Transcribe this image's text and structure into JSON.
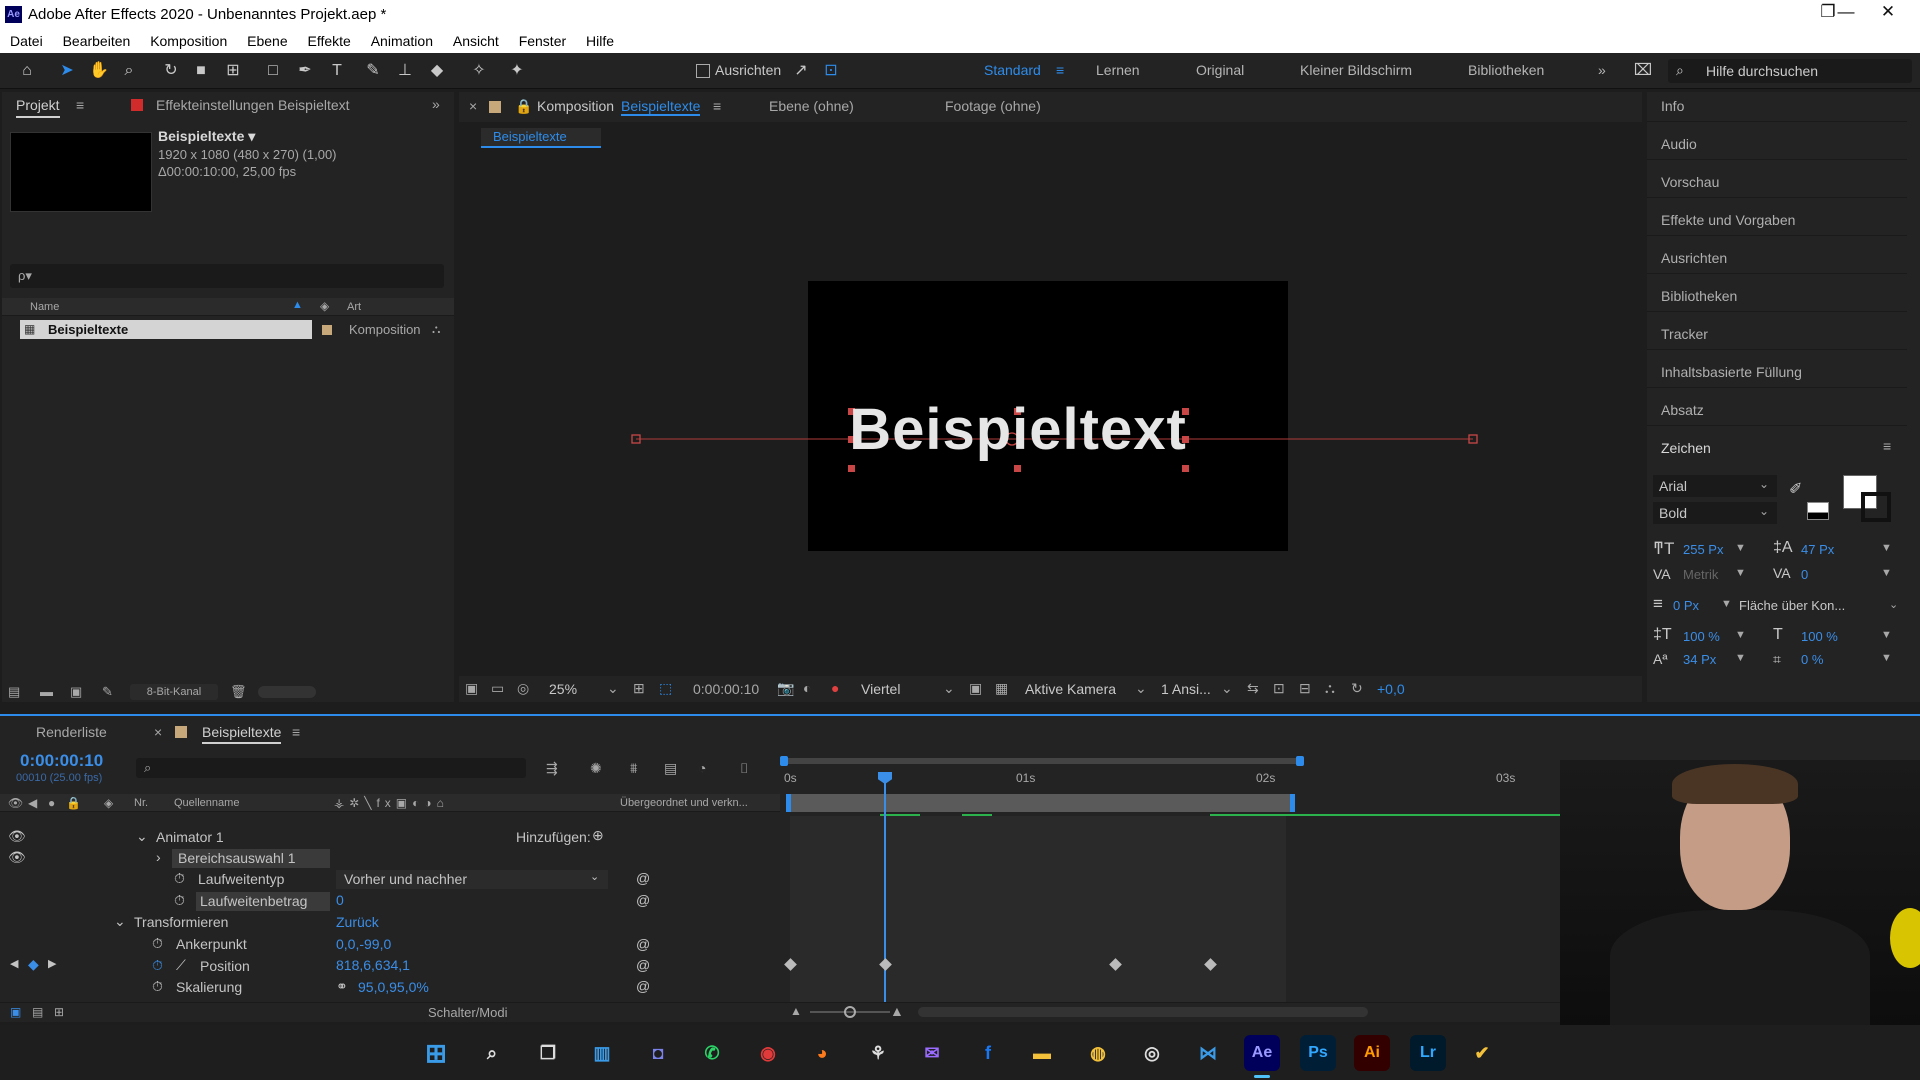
{
  "app": {
    "title": "Adobe After Effects 2020 - Unbenanntes Projekt.aep *",
    "icon": "Ae",
    "window_controls": [
      "—",
      "❐",
      "✕"
    ]
  },
  "menu": [
    "Datei",
    "Bearbeiten",
    "Komposition",
    "Ebene",
    "Effekte",
    "Animation",
    "Ansicht",
    "Fenster",
    "Hilfe"
  ],
  "toolbar": {
    "align_label": "Ausrichten",
    "workspaces": [
      "Standard",
      "Lernen",
      "Original",
      "Kleiner Bildschirm",
      "Bibliotheken"
    ],
    "active_workspace": "Standard",
    "overflow": "»",
    "search_placeholder": "Hilfe durchsuchen"
  },
  "project_panel": {
    "tab_project": "Projekt",
    "tab_effects": "Effekteinstellungen Beispieltext",
    "comp_name": "Beispieltexte ▾",
    "comp_info_1": "1920 x 1080 (480 x 270) (1,00)",
    "comp_info_2": "Δ00:00:10:00, 25,00 fps",
    "search_placeholder": "ρ▾",
    "col_name": "Name",
    "col_type": "Art",
    "item_name": "Beispieltexte",
    "item_type": "Komposition",
    "bit_depth": "8-Bit-Kanal"
  },
  "viewer": {
    "tab_comp_prefix": "Komposition",
    "tab_comp_name": "Beispieltexte",
    "tab_layer": "Ebene (ohne)",
    "tab_footage": "Footage (ohne)",
    "breadcrumb": "Beispieltexte",
    "canvas_text": "Beispieltext",
    "zoom": "25%",
    "timecode": "0:00:00:10",
    "resolution": "Viertel",
    "camera": "Aktive Kamera",
    "views": "1 Ansi...",
    "exposure": "+0,0"
  },
  "right_panel": {
    "items": [
      "Info",
      "Audio",
      "Vorschau",
      "Effekte und Vorgaben",
      "Ausrichten",
      "Bibliotheken",
      "Tracker",
      "Inhaltsbasierte Füllung",
      "Absatz"
    ],
    "zeichen_title": "Zeichen",
    "font": "Arial",
    "style": "Bold",
    "font_size": "255 Px",
    "leading": "47 Px",
    "kerning": "Metrik",
    "tracking": "0",
    "stroke_width": "0 Px",
    "stroke_mode": "Fläche über Kon...",
    "vscale": "100 %",
    "hscale": "100 %",
    "baseline": "34 Px",
    "tsume": "0 %",
    "fill_color": "#ffffff",
    "stroke_color": "#000000"
  },
  "timeline": {
    "tab_render": "Renderliste",
    "tab_comp": "Beispieltexte",
    "timecode": "0:00:00:10",
    "frame_info": "00010 (25.00 fps)",
    "col_nr": "Nr.",
    "col_source": "Quellenname",
    "col_parent": "Übergeordnet und verkn...",
    "ruler": [
      "0s",
      "01s",
      "02s",
      "03s"
    ],
    "rows": [
      {
        "name": "Animator 1",
        "value": "Hinzufügen:"
      },
      {
        "name": "Bereichsauswahl 1",
        "value": ""
      },
      {
        "name": "Laufweitentyp",
        "value": "Vorher und nachher"
      },
      {
        "name": "Laufweitenbetrag",
        "value": "0"
      },
      {
        "name": "Transformieren",
        "value": "Zurück"
      },
      {
        "name": "Ankerpunkt",
        "value": "0,0,-99,0"
      },
      {
        "name": "Position",
        "value": "818,6,634,1"
      },
      {
        "name": "Skalierung",
        "value": "95,0,95,0%"
      }
    ],
    "footer": "Schalter/Modi"
  },
  "taskbar": {
    "apps": [
      "windows-start",
      "search",
      "task-view",
      "widgets",
      "teams",
      "whatsapp",
      "camera",
      "firefox",
      "bookmark",
      "messenger",
      "facebook",
      "explorer",
      "chrome",
      "obs",
      "app-x",
      "after-effects",
      "photoshop",
      "illustrator",
      "lightroom",
      "norton"
    ],
    "labels": {
      "after-effects": "Ae",
      "photoshop": "Ps",
      "illustrator": "Ai",
      "lightroom": "Lr"
    },
    "colors": {
      "ae": "#9999ff",
      "ps": "#31a8ff",
      "ai": "#ff9a00",
      "lr": "#31a8ff"
    }
  }
}
